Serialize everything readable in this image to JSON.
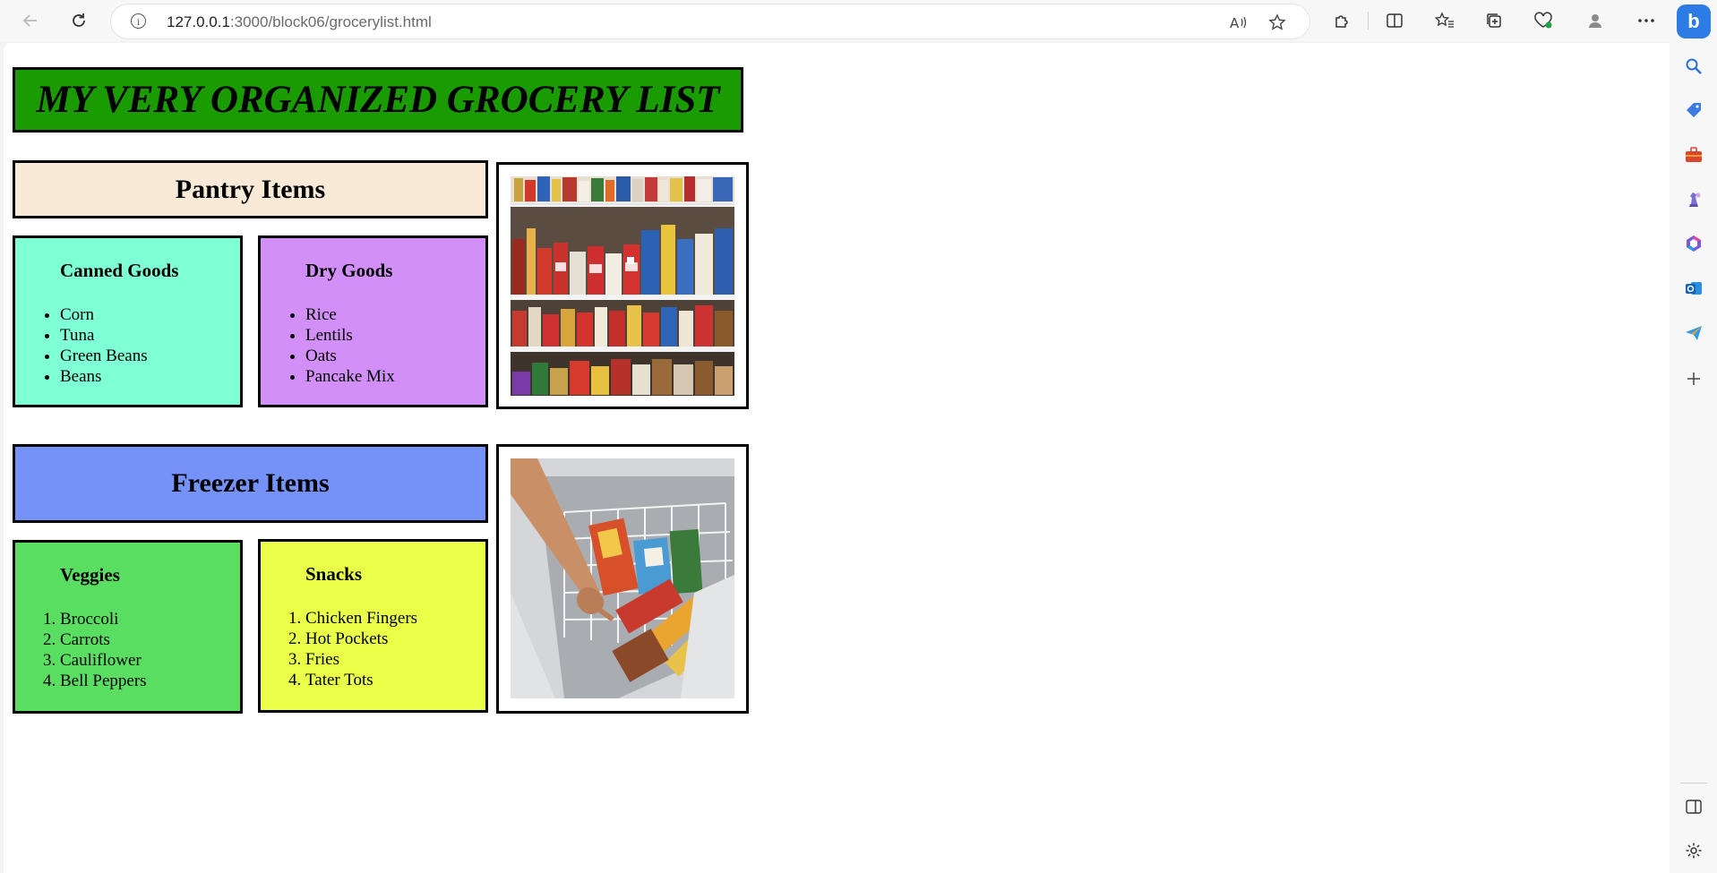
{
  "browser": {
    "url_host": "127.0.0.1",
    "url_rest": ":3000/block06/grocerylist.html",
    "back_icon": "arrow-left-icon",
    "reload_icon": "reload-icon"
  },
  "page": {
    "title": "MY VERY ORGANIZED GROCERY LIST",
    "pantry": {
      "heading": "Pantry Items",
      "canned": {
        "heading": "Canned Goods",
        "items": [
          "Corn",
          "Tuna",
          "Green Beans",
          "Beans"
        ]
      },
      "dry": {
        "heading": "Dry Goods",
        "items": [
          "Rice",
          "Lentils",
          "Oats",
          "Pancake Mix"
        ]
      }
    },
    "freezer": {
      "heading": "Freezer Items",
      "veggies": {
        "heading": "Veggies",
        "items": [
          "Broccoli",
          "Carrots",
          "Cauliflower",
          "Bell Peppers"
        ]
      },
      "snacks": {
        "heading": "Snacks",
        "items": [
          "Chicken Fingers",
          "Hot Pockets",
          "Fries",
          "Tater Tots"
        ]
      }
    }
  },
  "colors": {
    "title_bg": "#1a9b02",
    "pantry_bg": "#f9ead8",
    "canned_bg": "#7fffd4",
    "dry_bg": "#d18ff7",
    "freezer_bg": "#7492f7",
    "veggies_bg": "#5ade62",
    "snacks_bg": "#eaff48"
  }
}
